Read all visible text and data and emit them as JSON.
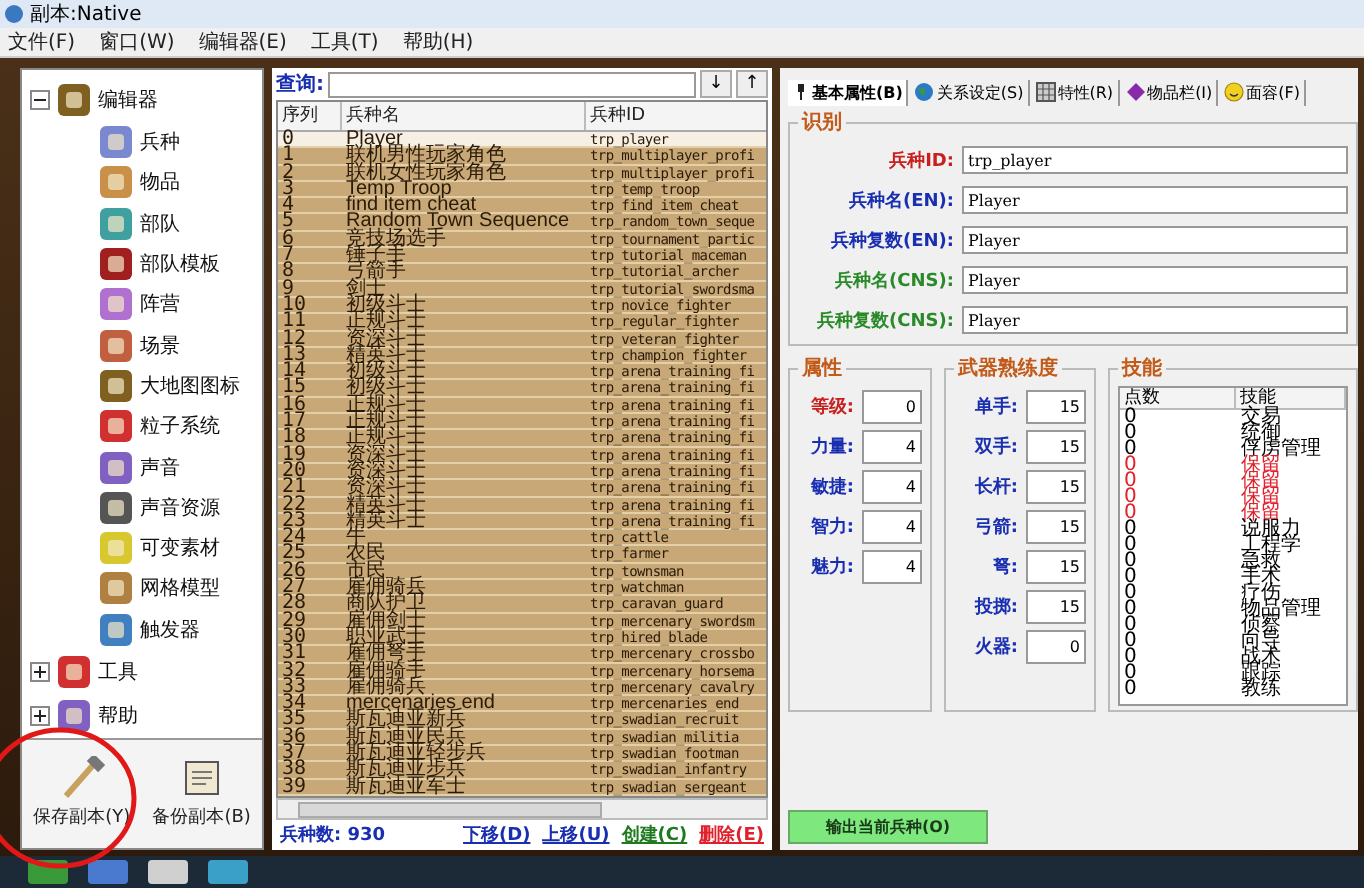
{
  "window": {
    "title": "副本:Native"
  },
  "menu": [
    "文件(F)",
    "窗口(W)",
    "编辑器(E)",
    "工具(T)",
    "帮助(H)"
  ],
  "tree": [
    {
      "label": "编辑器",
      "expanded": true,
      "children": [
        {
          "label": "兵种"
        },
        {
          "label": "物品"
        },
        {
          "label": "部队"
        },
        {
          "label": "部队模板"
        },
        {
          "label": "阵营"
        },
        {
          "label": "场景"
        },
        {
          "label": "大地图图标"
        },
        {
          "label": "粒子系统"
        },
        {
          "label": "声音"
        },
        {
          "label": "声音资源"
        },
        {
          "label": "可变素材"
        },
        {
          "label": "网格模型"
        },
        {
          "label": "触发器"
        }
      ]
    },
    {
      "label": "工具",
      "expanded": false
    },
    {
      "label": "帮助",
      "expanded": false
    }
  ],
  "left_buttons": [
    "保存副本(Y)",
    "备份副本(B)"
  ],
  "search": {
    "label": "查询:",
    "buttons": [
      "↓",
      "↑"
    ]
  },
  "troop_list": {
    "columns": [
      "序列",
      "兵种名",
      "兵种ID"
    ],
    "rows": [
      {
        "index": "0",
        "name": "Player",
        "id": "trp_player",
        "selected": true
      },
      {
        "index": "1",
        "name": "联机男性玩家角色",
        "id": "trp_multiplayer_profi",
        "selected": false
      },
      {
        "index": "2",
        "name": "联机女性玩家角色",
        "id": "trp_multiplayer_profi",
        "selected": false
      },
      {
        "index": "3",
        "name": "Temp Troop",
        "id": "trp_temp_troop",
        "selected": false
      },
      {
        "index": "4",
        "name": "find item cheat",
        "id": "trp_find_item_cheat",
        "selected": false
      },
      {
        "index": "5",
        "name": "Random Town Sequence",
        "id": "trp_random_town_seque",
        "selected": false
      },
      {
        "index": "6",
        "name": "竞技场选手",
        "id": "trp_tournament_partic",
        "selected": false
      },
      {
        "index": "7",
        "name": "锤子手",
        "id": "trp_tutorial_maceman",
        "selected": false
      },
      {
        "index": "8",
        "name": "弓箭手",
        "id": "trp_tutorial_archer",
        "selected": false
      },
      {
        "index": "9",
        "name": "剑士",
        "id": "trp_tutorial_swordsma",
        "selected": false
      },
      {
        "index": "10",
        "name": "初级斗士",
        "id": "trp_novice_fighter",
        "selected": false
      },
      {
        "index": "11",
        "name": "正规斗士",
        "id": "trp_regular_fighter",
        "selected": false
      },
      {
        "index": "12",
        "name": "资深斗士",
        "id": "trp_veteran_fighter",
        "selected": false
      },
      {
        "index": "13",
        "name": "精英斗士",
        "id": "trp_champion_fighter",
        "selected": false
      },
      {
        "index": "14",
        "name": "初级斗士",
        "id": "trp_arena_training_fi",
        "selected": false
      },
      {
        "index": "15",
        "name": "初级斗士",
        "id": "trp_arena_training_fi",
        "selected": false
      },
      {
        "index": "16",
        "name": "正规斗士",
        "id": "trp_arena_training_fi",
        "selected": false
      },
      {
        "index": "17",
        "name": "正规斗士",
        "id": "trp_arena_training_fi",
        "selected": false
      },
      {
        "index": "18",
        "name": "正规斗士",
        "id": "trp_arena_training_fi",
        "selected": false
      },
      {
        "index": "19",
        "name": "资深斗士",
        "id": "trp_arena_training_fi",
        "selected": false
      },
      {
        "index": "20",
        "name": "资深斗士",
        "id": "trp_arena_training_fi",
        "selected": false
      },
      {
        "index": "21",
        "name": "资深斗士",
        "id": "trp_arena_training_fi",
        "selected": false
      },
      {
        "index": "22",
        "name": "精英斗士",
        "id": "trp_arena_training_fi",
        "selected": false
      },
      {
        "index": "23",
        "name": "精英斗士",
        "id": "trp_arena_training_fi",
        "selected": false
      },
      {
        "index": "24",
        "name": "牛",
        "id": "trp_cattle",
        "selected": false
      },
      {
        "index": "25",
        "name": "农民",
        "id": "trp_farmer",
        "selected": false
      },
      {
        "index": "26",
        "name": "市民",
        "id": "trp_townsman",
        "selected": false
      },
      {
        "index": "27",
        "name": "雇佣骑兵",
        "id": "trp_watchman",
        "selected": false
      },
      {
        "index": "28",
        "name": "商队护卫",
        "id": "trp_caravan_guard",
        "selected": false
      },
      {
        "index": "29",
        "name": "雇佣剑士",
        "id": "trp_mercenary_swordsm",
        "selected": false
      },
      {
        "index": "30",
        "name": "职业武士",
        "id": "trp_hired_blade",
        "selected": false
      },
      {
        "index": "31",
        "name": "雇佣弩手",
        "id": "trp_mercenary_crossbo",
        "selected": false
      },
      {
        "index": "32",
        "name": "雇佣骑手",
        "id": "trp_mercenary_horsema",
        "selected": false
      },
      {
        "index": "33",
        "name": "雇佣骑兵",
        "id": "trp_mercenary_cavalry",
        "selected": false
      },
      {
        "index": "34",
        "name": "mercenaries end",
        "id": "trp_mercenaries_end",
        "selected": false
      },
      {
        "index": "35",
        "name": "斯瓦迪亚新兵",
        "id": "trp_swadian_recruit",
        "selected": false
      },
      {
        "index": "36",
        "name": "斯瓦迪亚民兵",
        "id": "trp_swadian_militia",
        "selected": false
      },
      {
        "index": "37",
        "name": "斯瓦迪亚轻步兵",
        "id": "trp_swadian_footman",
        "selected": false
      },
      {
        "index": "38",
        "name": "斯瓦迪亚步兵",
        "id": "trp_swadian_infantry",
        "selected": false
      },
      {
        "index": "39",
        "name": "斯瓦迪亚军士",
        "id": "trp_swadian_sergeant",
        "selected": false
      }
    ]
  },
  "list_footer": {
    "count": "兵种数: 930",
    "actions": [
      {
        "label": "下移(D)",
        "color": "#1a2fb0"
      },
      {
        "label": "上移(U)",
        "color": "#1a2fb0"
      },
      {
        "label": "创建(C)",
        "color": "#1e7a1e"
      },
      {
        "label": "删除(E)",
        "color": "#e0202a"
      }
    ]
  },
  "tabs": [
    {
      "label": "基本属性(B)",
      "selected": true
    },
    {
      "label": "关系设定(S)",
      "selected": false
    },
    {
      "label": "特性(R)",
      "selected": false
    },
    {
      "label": "物品栏(I)",
      "selected": false
    },
    {
      "label": "面容(F)",
      "selected": false
    }
  ],
  "identity": {
    "title": "识别",
    "fields": [
      {
        "label": "兵种ID:",
        "value": "trp_player",
        "color": "#c8201e"
      },
      {
        "label": "兵种名(EN):",
        "value": "Player",
        "color": "#1a2fb0"
      },
      {
        "label": "兵种复数(EN):",
        "value": "Player",
        "color": "#1a2fb0"
      },
      {
        "label": "兵种名(CNS):",
        "value": "Player",
        "color": "#2a8a2a"
      },
      {
        "label": "兵种复数(CNS):",
        "value": "Player",
        "color": "#2a8a2a"
      }
    ]
  },
  "attributes": {
    "title": "属性",
    "fields": [
      {
        "label": "等级:",
        "value": "0",
        "color": "#c8201e"
      },
      {
        "label": "力量:",
        "value": "4",
        "color": "#1a2fb0"
      },
      {
        "label": "敏捷:",
        "value": "4",
        "color": "#1a2fb0"
      },
      {
        "label": "智力:",
        "value": "4",
        "color": "#1a2fb0"
      },
      {
        "label": "魅力:",
        "value": "4",
        "color": "#1a2fb0"
      }
    ]
  },
  "proficiency": {
    "title": "武器熟练度",
    "fields": [
      {
        "label": "单手:",
        "value": "15"
      },
      {
        "label": "双手:",
        "value": "15"
      },
      {
        "label": "长杆:",
        "value": "15"
      },
      {
        "label": "弓箭:",
        "value": "15"
      },
      {
        "label": "弩:",
        "value": "15"
      },
      {
        "label": "投掷:",
        "value": "15"
      },
      {
        "label": "火器:",
        "value": "0"
      }
    ]
  },
  "skills": {
    "title": "技能",
    "columns": [
      "点数",
      "技能"
    ],
    "rows": [
      {
        "points": "0",
        "name": "交易",
        "color": "#000000"
      },
      {
        "points": "0",
        "name": "统御",
        "color": "#000000"
      },
      {
        "points": "0",
        "name": "俘虏管理",
        "color": "#000000"
      },
      {
        "points": "0",
        "name": "保留",
        "color": "#e0202a"
      },
      {
        "points": "0",
        "name": "保留",
        "color": "#e0202a"
      },
      {
        "points": "0",
        "name": "保留",
        "color": "#e0202a"
      },
      {
        "points": "0",
        "name": "保留",
        "color": "#e0202a"
      },
      {
        "points": "0",
        "name": "说服力",
        "color": "#000000"
      },
      {
        "points": "0",
        "name": "工程学",
        "color": "#000000"
      },
      {
        "points": "0",
        "name": "急救",
        "color": "#000000"
      },
      {
        "points": "0",
        "name": "手术",
        "color": "#000000"
      },
      {
        "points": "0",
        "name": "疗伤",
        "color": "#000000"
      },
      {
        "points": "0",
        "name": "物品管理",
        "color": "#000000"
      },
      {
        "points": "0",
        "name": "侦察",
        "color": "#000000"
      },
      {
        "points": "0",
        "name": "向导",
        "color": "#000000"
      },
      {
        "points": "0",
        "name": "战术",
        "color": "#000000"
      },
      {
        "points": "0",
        "name": "跟踪",
        "color": "#000000"
      },
      {
        "points": "0",
        "name": "教练",
        "color": "#000000"
      }
    ]
  },
  "export_button": "输出当前兵种(O)"
}
